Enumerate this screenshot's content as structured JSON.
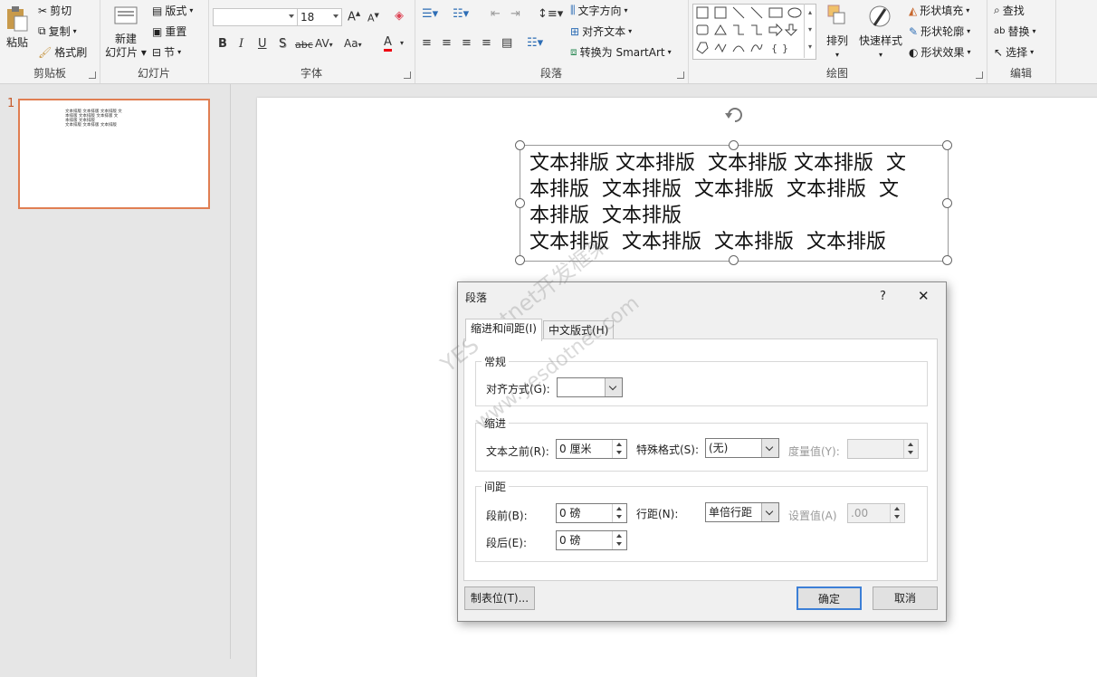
{
  "ribbon": {
    "clipboard": {
      "paste": "粘贴",
      "cut": "剪切",
      "copy": "复制",
      "format_painter": "格式刷",
      "label": "剪贴板"
    },
    "slides": {
      "new_slide_line1": "新建",
      "new_slide_line2": "幻灯片",
      "layout": "版式",
      "reset": "重置",
      "section": "节",
      "label": "幻灯片"
    },
    "font": {
      "font_name": "",
      "font_size": "18",
      "bold": "B",
      "italic": "I",
      "underline": "U",
      "shadow": "S",
      "strike": "abc",
      "spacing": "AV",
      "case": "Aa",
      "color": "A",
      "grow": "A",
      "shrink": "A",
      "label": "字体"
    },
    "paragraph": {
      "text_direction": "文字方向",
      "align_text": "对齐文本",
      "convert_smartart": "转换为 SmartArt",
      "label": "段落"
    },
    "drawing": {
      "arrange": "排列",
      "quick_styles": "快速样式",
      "shape_fill": "形状填充",
      "shape_outline": "形状轮廓",
      "shape_effects": "形状效果",
      "label": "绘图"
    },
    "editing": {
      "find": "查找",
      "replace": "替换",
      "select": "选择",
      "label": "编辑"
    }
  },
  "thumbnail": {
    "number": "1",
    "line1": "文本排版 文本排版 文本排版 文",
    "line2": "本排版 文本排版 文本排版 文",
    "line3": "本排版 文本排版",
    "line4": "文本排版 文本排版 文本排版"
  },
  "slide": {
    "line1": "文本排版 文本排版  文本排版 文本排版  文",
    "line2": "本排版  文本排版  文本排版  文本排版  文",
    "line3": "本排版  文本排版",
    "line4": "文本排版  文本排版  文本排版  文本排版"
  },
  "dialog": {
    "title": "段落",
    "help": "?",
    "close": "✕",
    "tabs": [
      "缩进和间距(I)",
      "中文版式(H)"
    ],
    "general": {
      "legend": "常规",
      "alignment_label": "对齐方式(G):",
      "alignment_value": ""
    },
    "indent": {
      "legend": "缩进",
      "before_text_label": "文本之前(R):",
      "before_text_value": "0 厘米",
      "special_label": "特殊格式(S):",
      "special_value": "(无)",
      "by_label": "度量值(Y):",
      "by_value": ""
    },
    "spacing": {
      "legend": "间距",
      "before_label": "段前(B):",
      "before_value": "0 磅",
      "after_label": "段后(E):",
      "after_value": "0 磅",
      "line_label": "行距(N):",
      "line_value": "单倍行距",
      "at_label": "设置值(A)",
      "at_value": ".00"
    },
    "tabs_button": "制表位(T)...",
    "ok": "确定",
    "cancel": "取消"
  },
  "watermark": {
    "line1": "YES dotnet开发框架",
    "line2": "www.yesdotnet.com"
  }
}
